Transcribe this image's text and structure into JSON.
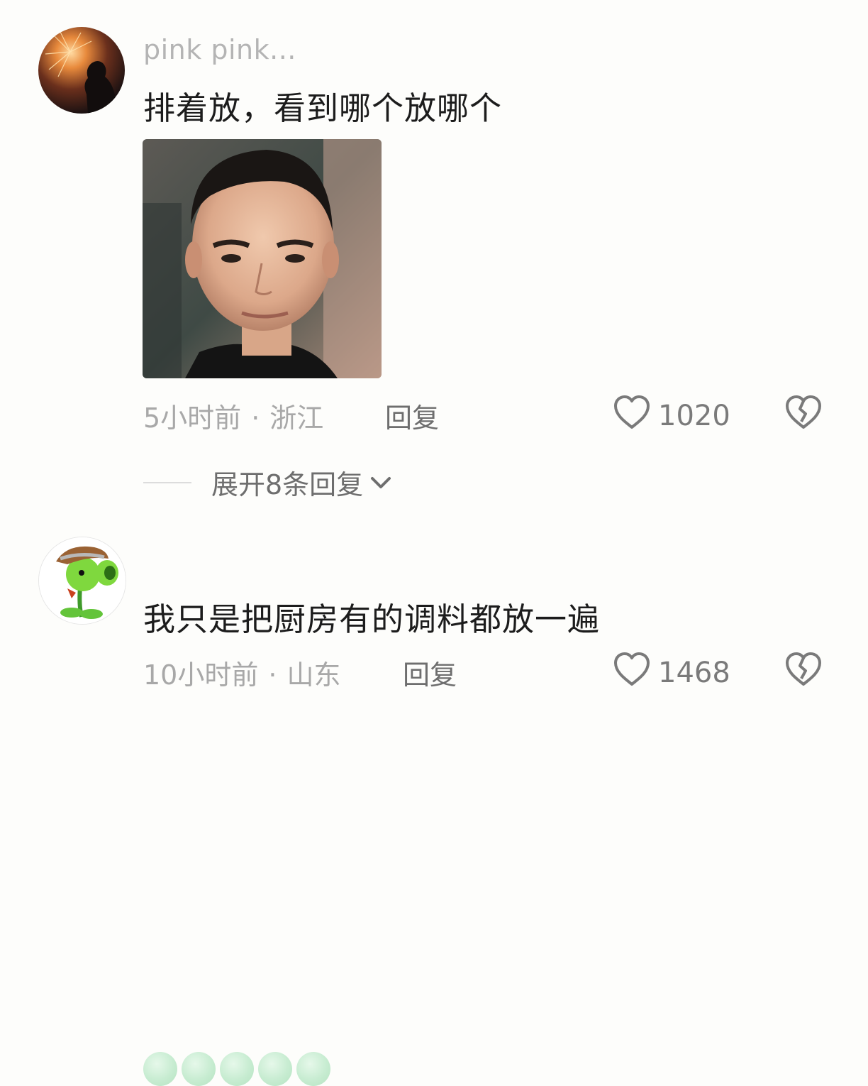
{
  "comments": [
    {
      "username": "pink pink...",
      "text": "排着放，看到哪个放哪个",
      "time": "5小时前",
      "location": "浙江",
      "reply_label": "回复",
      "likes": "1020",
      "expand_label": "展开8条回复"
    },
    {
      "username": "",
      "text": "我只是把厨房有的调料都放一遍",
      "time": "10小时前",
      "location": "山东",
      "reply_label": "回复",
      "likes": "1468"
    }
  ],
  "separator": "·",
  "icons": {
    "like": "heart-outline-icon",
    "dislike": "broken-heart-icon",
    "expand": "chevron-down-icon"
  },
  "colors": {
    "background": "#fdfdfb",
    "text": "#1c1c1c",
    "meta": "#a8a8a8",
    "username": "#b4b4b4"
  }
}
